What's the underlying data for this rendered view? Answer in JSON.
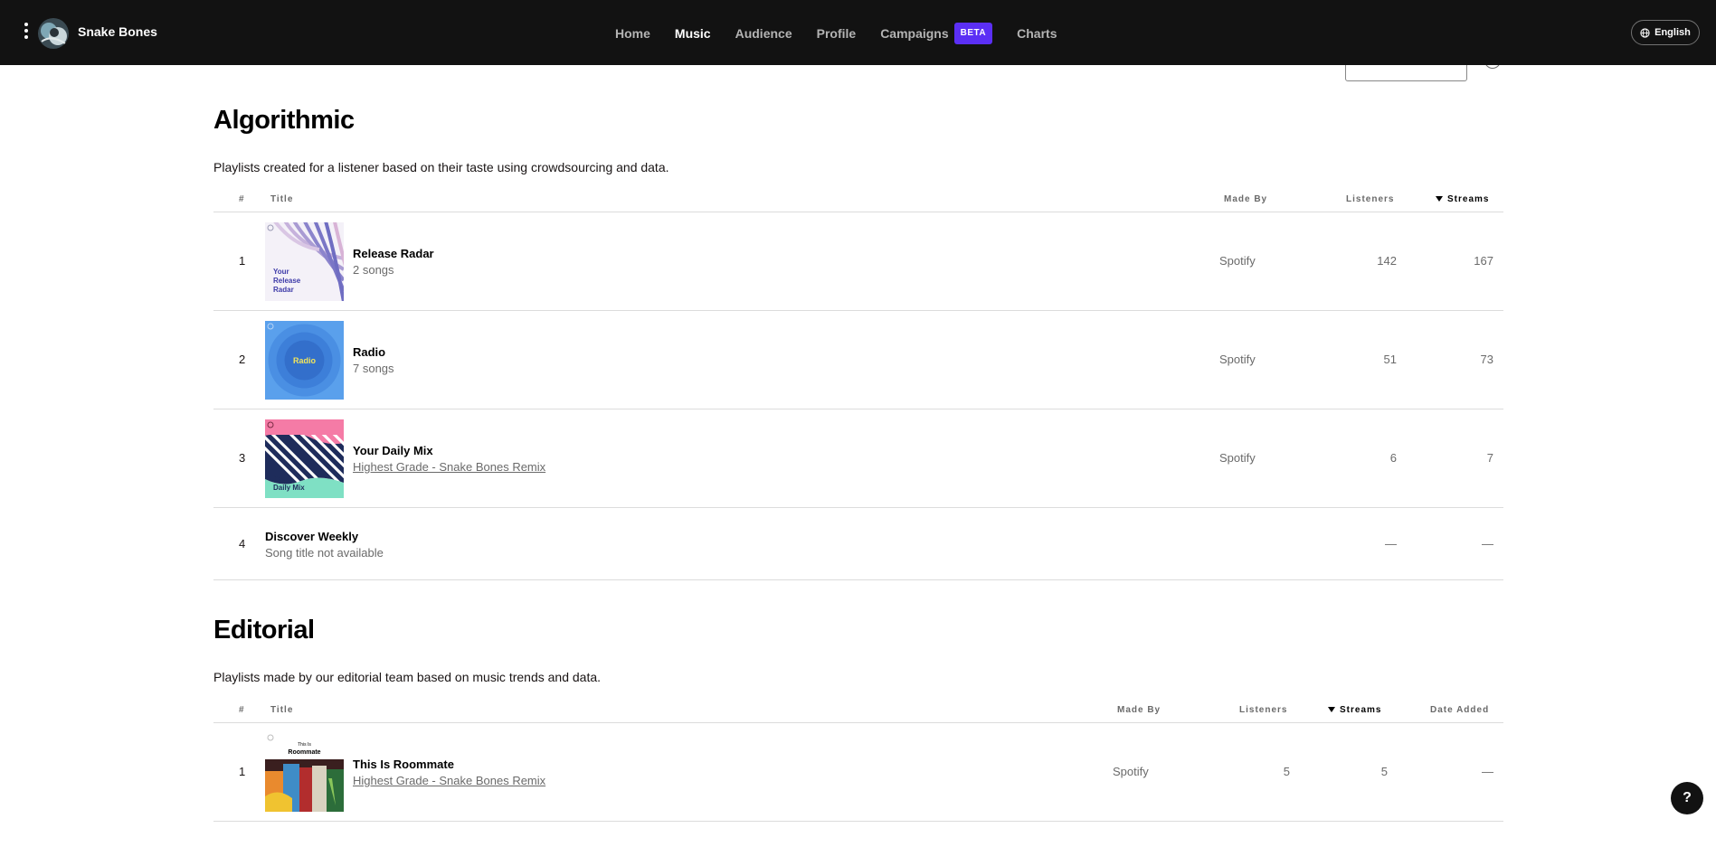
{
  "header": {
    "artist_name": "Snake Bones",
    "nav": [
      "Home",
      "Music",
      "Audience",
      "Profile",
      "Campaigns",
      "Charts"
    ],
    "active_nav": "Music",
    "campaigns_badge": "BETA",
    "language": "English"
  },
  "algorithmic": {
    "title": "Algorithmic",
    "description": "Playlists created for a listener based on their taste using crowdsourcing and data.",
    "columns": {
      "num": "#",
      "title": "Title",
      "made_by": "Made By",
      "listeners": "Listeners",
      "streams": "Streams"
    },
    "rows": [
      {
        "num": "1",
        "title": "Release Radar",
        "subtitle": "2 songs",
        "made_by": "Spotify",
        "listeners": "142",
        "streams": "167"
      },
      {
        "num": "2",
        "title": "Radio",
        "subtitle": "7 songs",
        "made_by": "Spotify",
        "listeners": "51",
        "streams": "73"
      },
      {
        "num": "3",
        "title": "Your Daily Mix",
        "subtitle": "Highest Grade - Snake Bones Remix",
        "made_by": "Spotify",
        "listeners": "6",
        "streams": "7"
      },
      {
        "num": "4",
        "title": "Discover Weekly",
        "subtitle": "Song title not available",
        "made_by": "",
        "listeners": "—",
        "streams": "—"
      }
    ],
    "covers": {
      "release_radar": "Your Release Radar",
      "radio": "Radio",
      "daily_mix": "Your Daily Mix"
    }
  },
  "editorial": {
    "title": "Editorial",
    "description": "Playlists made by our editorial team based on music trends and data.",
    "columns": {
      "num": "#",
      "title": "Title",
      "made_by": "Made By",
      "listeners": "Listeners",
      "streams": "Streams",
      "date_added": "Date Added"
    },
    "rows": [
      {
        "num": "1",
        "title": "This Is Roommate",
        "subtitle": "Highest Grade - Snake Bones Remix",
        "made_by": "Spotify",
        "listeners": "5",
        "streams": "5",
        "date_added": "—"
      }
    ],
    "covers": {
      "this_is": "This Is",
      "this_is_name": "Roommate"
    }
  },
  "colors": {
    "topbar": "#121212",
    "beta_badge": "#5b2ff5",
    "divider": "#dcdcdc",
    "muted_text": "#6a6a6a"
  },
  "icons": [
    "kebab-menu-icon",
    "globe-icon",
    "info-icon",
    "sort-desc-icon",
    "help-icon"
  ],
  "help_label": "?"
}
